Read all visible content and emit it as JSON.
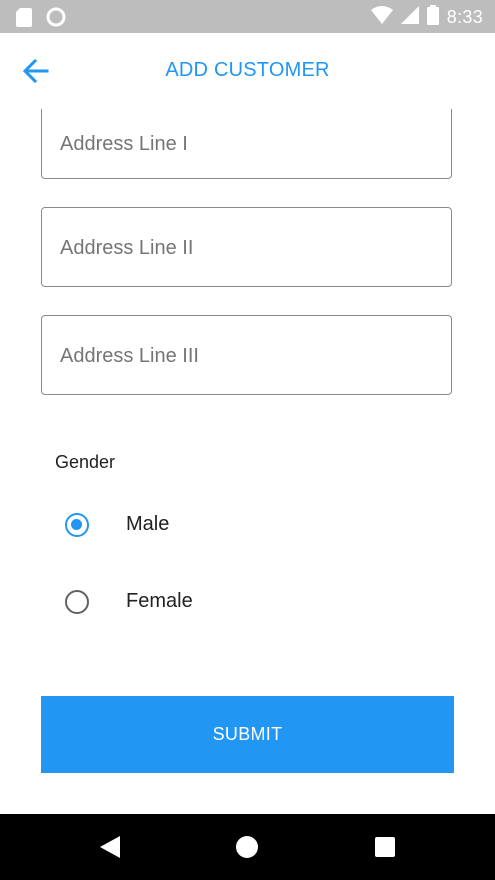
{
  "status_bar": {
    "time": "8:33",
    "icons": [
      "sd-card-icon",
      "circle-notification-icon",
      "wifi-icon",
      "cell-signal-icon",
      "battery-icon"
    ]
  },
  "app_bar": {
    "title": "ADD CUSTOMER",
    "back_icon": "arrow-left-icon"
  },
  "form": {
    "address_line_1": {
      "placeholder": "Address Line I",
      "value": ""
    },
    "address_line_2": {
      "placeholder": "Address Line II",
      "value": ""
    },
    "address_line_3": {
      "placeholder": "Address Line III",
      "value": ""
    },
    "gender": {
      "label": "Gender",
      "options": [
        {
          "label": "Male",
          "checked": true
        },
        {
          "label": "Female",
          "checked": false
        }
      ]
    },
    "submit_label": "SUBMIT"
  },
  "nav_bar": {
    "icons": [
      "back-triangle-icon",
      "home-circle-icon",
      "recents-square-icon"
    ]
  },
  "colors": {
    "accent": "#2196f3",
    "status_bar": "#bdbdbd",
    "nav_bar": "#000000"
  }
}
